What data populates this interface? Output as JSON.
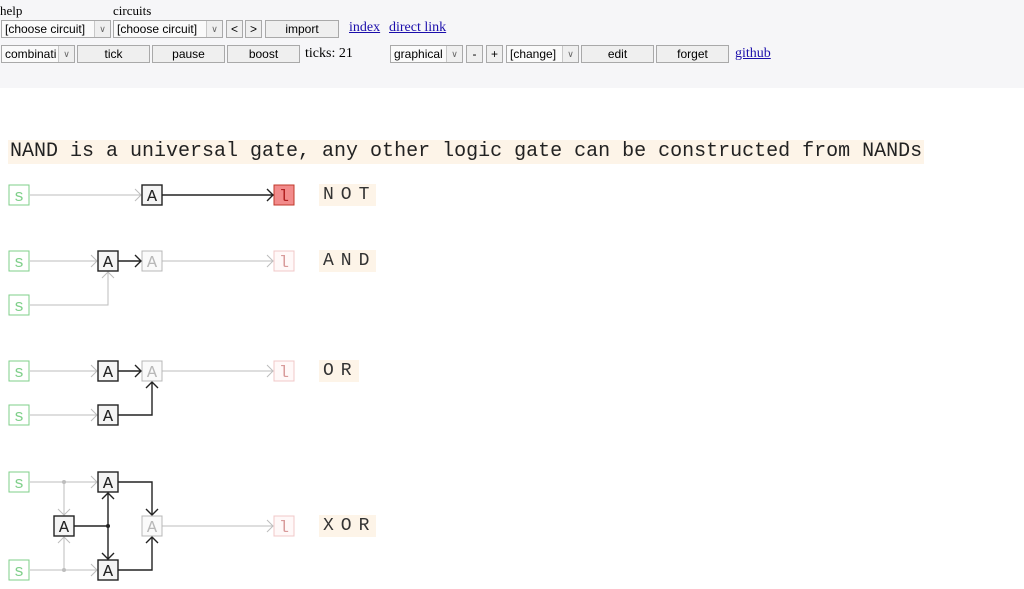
{
  "toolbar": {
    "help_label": "help",
    "circuits_label": "circuits",
    "help_select": "[choose circuit]",
    "circuits_select": "[choose circuit]",
    "prev_label": "<",
    "next_label": ">",
    "import_label": "import",
    "index_link": "index",
    "direct_link": "direct link",
    "mode_select": "combinati",
    "tick_label": "tick",
    "pause_label": "pause",
    "boost_label": "boost",
    "ticks_text": "ticks: 21",
    "view_select": "graphical",
    "zoom_out_label": "-",
    "zoom_in_label": "+",
    "change_select": "[change]",
    "edit_label": "edit",
    "forget_label": "forget",
    "github_link": "github"
  },
  "title": "NAND is a universal gate, any other logic gate can be constructed from NANDs",
  "colors": {
    "switch": "#7fcf8a",
    "gate_on": "#222222",
    "gate_off": "#b8b8b8",
    "led_on_fill": "#f28b8b",
    "led_on_border": "#c0392b",
    "led_off_border": "#f0c8c8",
    "wire_on": "#222222",
    "wire_off": "#bdbdbd",
    "caption_bg": "#fdf4e8"
  },
  "circuits": [
    {
      "name": "NOT",
      "caption": "NOT"
    },
    {
      "name": "AND",
      "caption": "AND"
    },
    {
      "name": "OR",
      "caption": "OR"
    },
    {
      "name": "XOR",
      "caption": "XOR"
    }
  ],
  "symbols": {
    "switch": "s",
    "nand": "A",
    "led": "l"
  },
  "states": {
    "not_output_on": true,
    "and_output_on": false,
    "or_output_on": false,
    "xor_output_on": false
  }
}
